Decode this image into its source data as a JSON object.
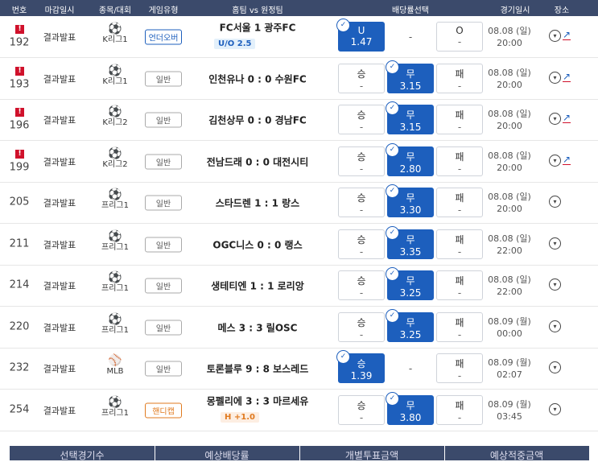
{
  "header": {
    "col_no": "번호",
    "col_deadline": "마감일시",
    "col_sport": "종목/대회",
    "col_type": "게임유형",
    "col_match": "홈팀 vs 원정팀",
    "col_odds": "배당률선택",
    "col_datetime": "경기일시",
    "col_venue": "장소"
  },
  "rows": [
    {
      "num": "192",
      "alert": "!",
      "status": "결과발표",
      "sport_icon": "⚽",
      "league": "K리그1",
      "type": "언더오버",
      "match": "FC서울   1   광주FC",
      "sub": "U/O 2.5",
      "b1_label": "U",
      "b1_val": "1.47",
      "b2_label": "-",
      "b2_val": "",
      "b3_label": "O",
      "b3_val": "-",
      "date": "08.08 (일)",
      "time": "20:00"
    },
    {
      "num": "193",
      "alert": "!",
      "status": "결과발표",
      "sport_icon": "⚽",
      "league": "K리그1",
      "type": "일반",
      "match": "인천유나 0 : 0 수원FC",
      "sub": "",
      "b1_label": "승",
      "b1_val": "-",
      "b2_label": "무",
      "b2_val": "3.15",
      "b3_label": "패",
      "b3_val": "-",
      "date": "08.08 (일)",
      "time": "20:00"
    },
    {
      "num": "196",
      "alert": "!",
      "status": "결과발표",
      "sport_icon": "⚽",
      "league": "K리그2",
      "type": "일반",
      "match": "김천상무 0 : 0 경남FC",
      "sub": "",
      "b1_label": "승",
      "b1_val": "-",
      "b2_label": "무",
      "b2_val": "3.15",
      "b3_label": "패",
      "b3_val": "-",
      "date": "08.08 (일)",
      "time": "20:00"
    },
    {
      "num": "199",
      "alert": "!",
      "status": "결과발표",
      "sport_icon": "⚽",
      "league": "K리그2",
      "type": "일반",
      "match": "전남드래 0 : 0 대전시티",
      "sub": "",
      "b1_label": "승",
      "b1_val": "-",
      "b2_label": "무",
      "b2_val": "2.80",
      "b3_label": "패",
      "b3_val": "-",
      "date": "08.08 (일)",
      "time": "20:00"
    },
    {
      "num": "205",
      "alert": "",
      "status": "결과발표",
      "sport_icon": "⚽",
      "league": "프리그1",
      "type": "일반",
      "match": "스타드렌 1 : 1 랑스",
      "sub": "",
      "b1_label": "승",
      "b1_val": "-",
      "b2_label": "무",
      "b2_val": "3.30",
      "b3_label": "패",
      "b3_val": "-",
      "date": "08.08 (일)",
      "time": "20:00"
    },
    {
      "num": "211",
      "alert": "",
      "status": "결과발표",
      "sport_icon": "⚽",
      "league": "프리그1",
      "type": "일반",
      "match": "OGC니스 0 : 0 랭스",
      "sub": "",
      "b1_label": "승",
      "b1_val": "-",
      "b2_label": "무",
      "b2_val": "3.35",
      "b3_label": "패",
      "b3_val": "-",
      "date": "08.08 (일)",
      "time": "22:00"
    },
    {
      "num": "214",
      "alert": "",
      "status": "결과발표",
      "sport_icon": "⚽",
      "league": "프리그1",
      "type": "일반",
      "match": "생테티엔 1 : 1 로리앙",
      "sub": "",
      "b1_label": "승",
      "b1_val": "-",
      "b2_label": "무",
      "b2_val": "3.25",
      "b3_label": "패",
      "b3_val": "-",
      "date": "08.08 (일)",
      "time": "22:00"
    },
    {
      "num": "220",
      "alert": "",
      "status": "결과발표",
      "sport_icon": "⚽",
      "league": "프리그1",
      "type": "일반",
      "match": "메스 3 : 3 릴OSC",
      "sub": "",
      "b1_label": "승",
      "b1_val": "-",
      "b2_label": "무",
      "b2_val": "3.25",
      "b3_label": "패",
      "b3_val": "-",
      "date": "08.09 (월)",
      "time": "00:00"
    },
    {
      "num": "232",
      "alert": "",
      "status": "결과발표",
      "sport_icon": "⚾",
      "league": "MLB",
      "type": "일반",
      "match": "토론블루 9 : 8 보스레드",
      "sub": "",
      "b1_label": "승",
      "b1_val": "1.39",
      "b2_label": "-",
      "b2_val": "",
      "b3_label": "패",
      "b3_val": "-",
      "date": "08.09 (월)",
      "time": "02:07"
    },
    {
      "num": "254",
      "alert": "",
      "status": "결과발표",
      "sport_icon": "⚽",
      "league": "프리그1",
      "type": "핸디캡",
      "match": "몽펠리에 3 : 3 마르세유",
      "sub": "H +1.0",
      "b1_label": "승",
      "b1_val": "-",
      "b2_label": "무",
      "b2_val": "3.80",
      "b3_label": "패",
      "b3_val": "-",
      "date": "08.09 (월)",
      "time": "03:45"
    }
  ],
  "footer": {
    "selected_games": "선택경기수",
    "expected_odds": "예상배당률",
    "bet_amount": "개별투표금액",
    "expected_payout": "예상적중금액"
  },
  "colors": {
    "header_bg": "#3b4a6b",
    "selected": "#1d5fbd",
    "alert": "#d0112b",
    "handicap": "#e07a1f"
  }
}
